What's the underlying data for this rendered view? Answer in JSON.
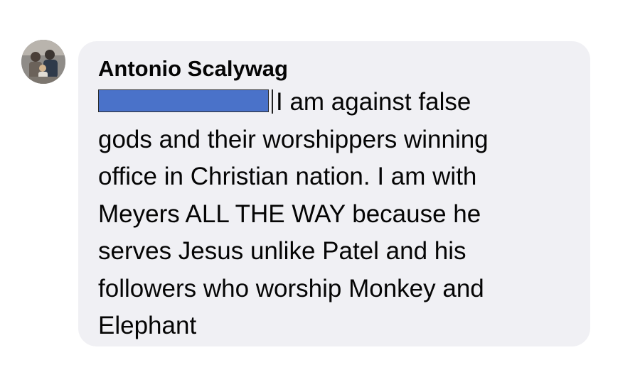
{
  "comment": {
    "author_name": "Antonio Scalywag",
    "avatar_icon": "user-photo-avatar",
    "redaction_color": "#4a72c9",
    "bubble_color": "#f0f0f4",
    "lines": [
      "I am against false",
      "gods and their worshippers winning",
      "office in Christian nation. I am with",
      "Meyers ALL THE WAY because he",
      "serves Jesus unlike Patel and his",
      "followers who worship Monkey and",
      "Elephant"
    ]
  }
}
